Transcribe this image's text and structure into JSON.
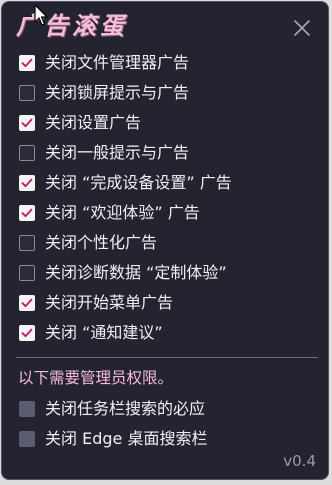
{
  "app": {
    "title": "广告滚蛋",
    "version": "v0.4"
  },
  "colors": {
    "panel_bg": "#242431",
    "accent_pink": "#f6bcd9",
    "check_color": "#c2185b"
  },
  "options": [
    {
      "label": "关闭文件管理器广告",
      "checked": true
    },
    {
      "label": "关闭锁屏提示与广告",
      "checked": false
    },
    {
      "label": "关闭设置广告",
      "checked": true
    },
    {
      "label": "关闭一般提示与广告",
      "checked": false
    },
    {
      "label": "关闭 “完成设备设置” 广告",
      "checked": true
    },
    {
      "label": "关闭 “欢迎体验” 广告",
      "checked": true
    },
    {
      "label": "关闭个性化广告",
      "checked": false
    },
    {
      "label": "关闭诊断数据 “定制体验”",
      "checked": false
    },
    {
      "label": "关闭开始菜单广告",
      "checked": true
    },
    {
      "label": "关闭 “通知建议”",
      "checked": true
    }
  ],
  "admin": {
    "note": "以下需要管理员权限。",
    "options": [
      {
        "label": "关闭任务栏搜索的必应",
        "checked": false
      },
      {
        "label": "关闭 Edge 桌面搜索栏",
        "checked": false
      }
    ]
  },
  "icons": {
    "close": "close-icon",
    "cursor": "mouse-pointer-icon",
    "check": "checkmark-icon"
  }
}
